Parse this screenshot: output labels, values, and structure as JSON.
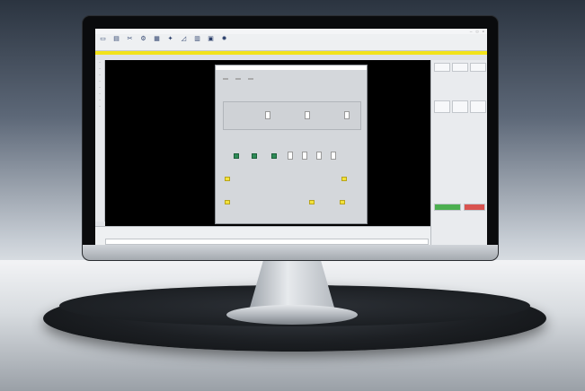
{
  "app": {
    "window_controls": [
      "—",
      "□",
      "×"
    ],
    "ribbon_icons": [
      {
        "icon": "new-file-icon",
        "glyph": "▭"
      },
      {
        "icon": "open-file-icon",
        "glyph": "▤"
      },
      {
        "icon": "scissors-icon",
        "glyph": "✂"
      },
      {
        "icon": "gear-list-icon",
        "glyph": "⚙"
      },
      {
        "icon": "grid-icon",
        "glyph": "▦"
      },
      {
        "icon": "tool-icon",
        "glyph": "✦"
      },
      {
        "icon": "ruler-icon",
        "glyph": "◿"
      },
      {
        "icon": "table-icon",
        "glyph": "▥"
      },
      {
        "icon": "layers-icon",
        "glyph": "▣"
      },
      {
        "icon": "settings-icon",
        "glyph": "✹"
      }
    ]
  },
  "dialog": {
    "accent": "#f3e23a"
  },
  "colors": {
    "canvas": "#000000",
    "highlight_bar": "#f2e31a",
    "accent_green": "#2e8b57",
    "accent_red": "#d9534f"
  }
}
